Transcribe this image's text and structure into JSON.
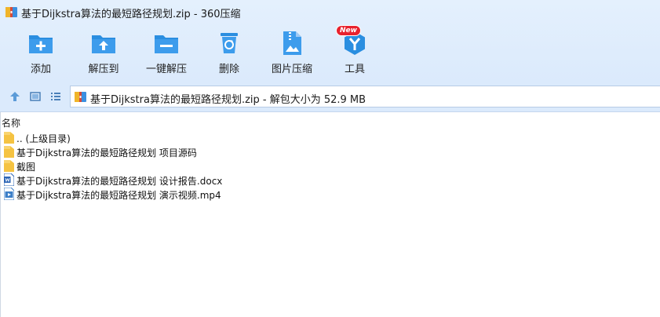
{
  "window": {
    "title": "基于Dijkstra算法的最短路径规划.zip - 360压缩"
  },
  "toolbar": {
    "buttons": [
      {
        "label": "添加",
        "icon": "add-folder-icon"
      },
      {
        "label": "解压到",
        "icon": "extract-to-icon"
      },
      {
        "label": "一键解压",
        "icon": "one-click-extract-icon"
      },
      {
        "label": "删除",
        "icon": "delete-icon"
      },
      {
        "label": "图片压缩",
        "icon": "image-compress-icon"
      },
      {
        "label": "工具",
        "icon": "tools-icon",
        "badge": "New"
      }
    ]
  },
  "address_bar": {
    "text": "基于Dijkstra算法的最短路径规划.zip - 解包大小为 52.9 MB"
  },
  "columns": {
    "name": "名称"
  },
  "files": [
    {
      "name": ".. (上级目录)",
      "type": "folder"
    },
    {
      "name": "基于Dijkstra算法的最短路径规划 项目源码",
      "type": "folder"
    },
    {
      "name": "截图",
      "type": "folder"
    },
    {
      "name": "基于Dijkstra算法的最短路径规划 设计报告.docx",
      "type": "docx"
    },
    {
      "name": "基于Dijkstra算法的最短路径规划 演示视频.mp4",
      "type": "mp4"
    }
  ],
  "colors": {
    "accent": "#2a8ee0",
    "folder": "#f5c342",
    "badge": "#e8222e"
  }
}
